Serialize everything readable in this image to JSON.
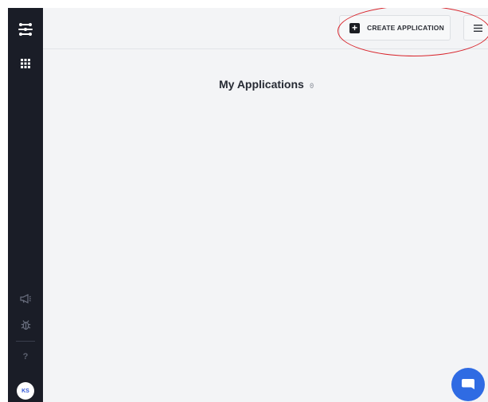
{
  "header": {
    "create_button_label": "CREATE APPLICATION",
    "create_icon": "plus-square-icon",
    "menu_icon": "hamburger-menu-icon"
  },
  "main": {
    "title": "My Applications",
    "count": "0"
  },
  "sidebar": {
    "logo_icon": "app-logo-icon",
    "apps_icon": "grid-apps-icon",
    "announcements_icon": "megaphone-icon",
    "debug_icon": "bug-icon",
    "help_label": "?",
    "avatar_initials": "KS"
  },
  "chat": {
    "icon": "chat-bubble-icon"
  },
  "colors": {
    "sidebar_bg": "#1a1d27",
    "page_bg": "#f3f4f6",
    "accent": "#2f6be3",
    "annotation": "#d8232a"
  }
}
